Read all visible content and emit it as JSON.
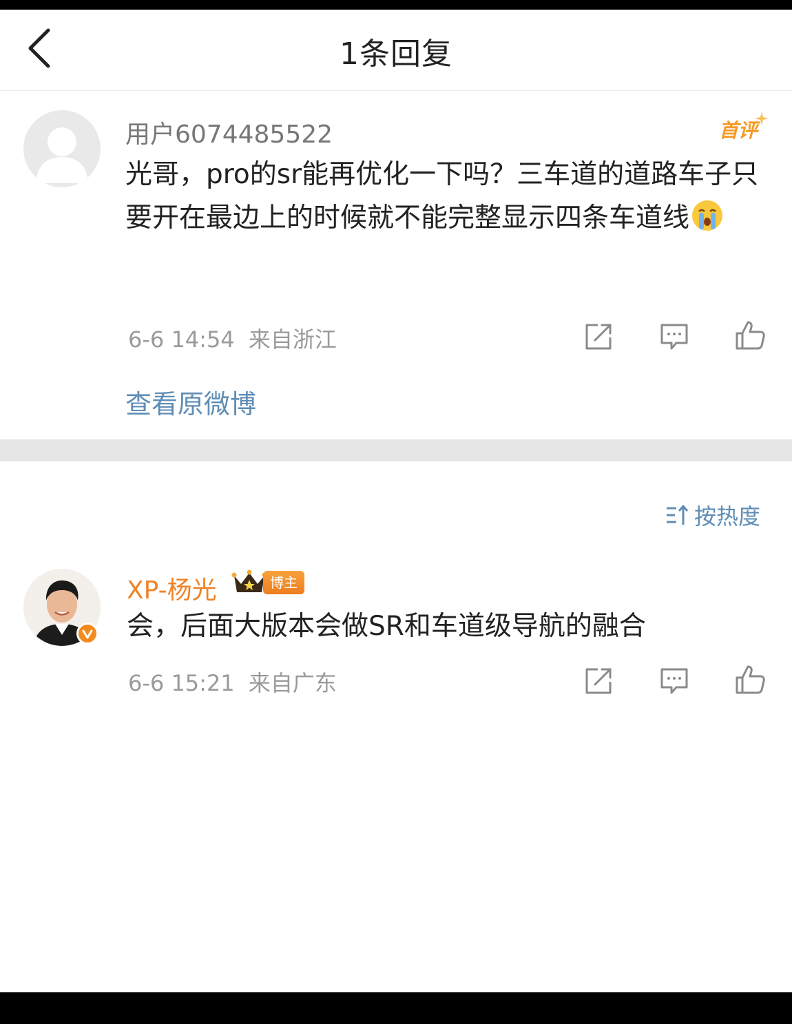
{
  "header": {
    "title": "1条回复",
    "back_icon": "chevron-left-icon"
  },
  "root_comment": {
    "username": "用户6074485522",
    "badge": "首评",
    "text": "光哥，pro的sr能再优化一下吗？三车道的道路车子只要开在最边上的时候就不能完整显示四条车道线",
    "emoji": "crying-face-icon",
    "time": "6-6 14:54",
    "location": "来自浙江",
    "view_original": "查看原微博"
  },
  "sort": {
    "label": "按热度",
    "icon": "sort-icon"
  },
  "reply": {
    "author": "XP-杨光",
    "tag": "博主",
    "text": "会，后面大版本会做SR和车道级导航的融合",
    "time": "6-6 15:21",
    "location": "来自广东"
  },
  "actions": [
    "share-icon",
    "comment-icon",
    "like-icon"
  ],
  "colors": {
    "link_blue": "#5f8db5",
    "author_orange": "#f08327",
    "meta_gray": "#9a9a9a",
    "badge_orange": "#f59a23"
  }
}
